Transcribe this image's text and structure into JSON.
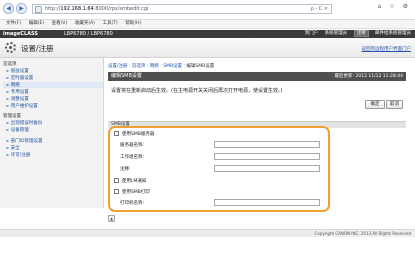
{
  "browser": {
    "url_host": "192.168.1.64",
    "url_prefix": "http://",
    "url_rest": ":8000/rps/smbedit.cgi",
    "address_controls": "ρ - C ×",
    "window_icons": "⌂ ☆ ⚙",
    "menu": [
      "文件(F)",
      "编辑(E)",
      "查看(V)",
      "收藏夹(A)",
      "工具(T)",
      "帮助(H)"
    ]
  },
  "header": {
    "brand": "imageCLASS",
    "model": "LBP6780 / LBP6780",
    "links": [
      "到门户",
      "系统管理员",
      "注销",
      "邮件给系统管理员"
    ],
    "page_title": "设置/注册",
    "portal_link": "返回到远程用户界面门户"
  },
  "sidebar": {
    "sections": [
      {
        "title": "首选项",
        "items": [
          "纸张设置",
          "定时器设置"
        ]
      },
      {
        "title": "",
        "items": [
          "网络",
          "专用设置",
          "调整设置",
          "用户维护设置"
        ]
      },
      {
        "title": "管理设置",
        "items": [
          "出现错误时备份",
          "设备管理"
        ]
      },
      {
        "title": "",
        "items": [
          "部门ID管理设置",
          "安全",
          "许可/注册"
        ]
      }
    ]
  },
  "main": {
    "breadcrumb": [
      "设置/注册",
      "首选项",
      "网络",
      "SMB设置"
    ],
    "breadcrumb_last": "编辑SMB设置",
    "panel_title": "编辑SMB设置",
    "last_updated": "最后更新: 2012 11/12 11:28:44",
    "notice": "设置将在重新启动后生效。(在主电源开关关闭后再次打开电源，使设置生效。)",
    "ok_label": "确定",
    "cancel_label": "取消",
    "section_title": "SMB设置",
    "form": {
      "use_smb_server": "使用SMB服务器",
      "server_name": "服务器名称:",
      "workgroup_name": "工作组名称:",
      "comment": "注释:",
      "use_lm": "使用LM通知",
      "use_smb_print": "使用SMB打印",
      "printer_name": "打印机名称:"
    },
    "up_icon": "▲"
  },
  "footer": {
    "copyright": "Copyright CANON INC. 2013 All Rights Reserved"
  }
}
